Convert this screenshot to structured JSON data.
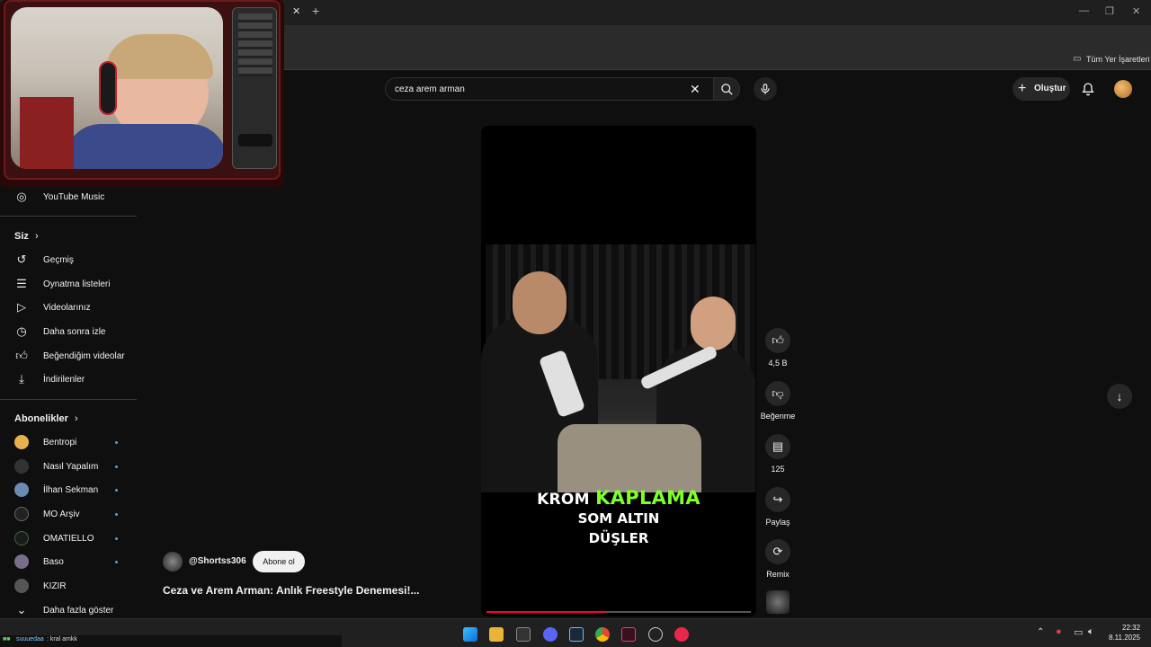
{
  "browser": {
    "bookmarks_label": "Tüm Yer İşaretleri"
  },
  "header": {
    "search_value": "ceza arem arman",
    "create_label": "Oluştur"
  },
  "sidebar": {
    "top_items": [
      {
        "label": "YouTube Music",
        "icon": "youtube-music-icon"
      }
    ],
    "you_heading": "Siz",
    "you_items": [
      {
        "label": "Geçmiş",
        "icon": "history-icon"
      },
      {
        "label": "Oynatma listeleri",
        "icon": "playlist-icon"
      },
      {
        "label": "Videolarınız",
        "icon": "your-videos-icon"
      },
      {
        "label": "Daha sonra izle",
        "icon": "watch-later-icon"
      },
      {
        "label": "Beğendiğim videolar",
        "icon": "liked-videos-icon"
      },
      {
        "label": "İndirilenler",
        "icon": "download-icon"
      }
    ],
    "subs_heading": "Abonelikler",
    "subscriptions": [
      {
        "label": "Bentropi",
        "color": "#e8b04a",
        "new": true
      },
      {
        "label": "Nasıl Yapalım",
        "color": "#333333",
        "new": true
      },
      {
        "label": "İlhan Sekman",
        "color": "#6a8caf",
        "new": true
      },
      {
        "label": "MO Arşiv",
        "color": "#222222",
        "new": true
      },
      {
        "label": "OMATIELLO",
        "color": "#1a1a1a",
        "new": true
      },
      {
        "label": "Baso",
        "color": "#7a6f8a",
        "new": true
      },
      {
        "label": "KIZIR",
        "color": "#555555",
        "new": false
      }
    ],
    "show_more": "Daha fazla göster"
  },
  "short": {
    "channel": "@Shortss306",
    "subscribe_label": "Abone ol",
    "title": "Ceza ve Arem Arman: Anlık Freestyle Denemesi!...",
    "caption_line1_white": "KROM ",
    "caption_line1_green": "KAPLAMA",
    "caption_line2": "SOM ALTIN",
    "caption_line3": "DÜŞLER",
    "progress": 0.45
  },
  "actions": {
    "like_count": "4,5 B",
    "dislike_label": "Beğenme",
    "comment_count": "125",
    "share_label": "Paylaş",
    "remix_label": "Remix"
  },
  "taskbar": {
    "time": "22:32",
    "date": "8.11.2025",
    "chat_user": "suuuedaa",
    "chat_message": ": kral amkk"
  },
  "colors": {
    "accent_green": "#7dff2a",
    "progress_red": "#ff0033",
    "link_blue": "#3ea6ff"
  }
}
